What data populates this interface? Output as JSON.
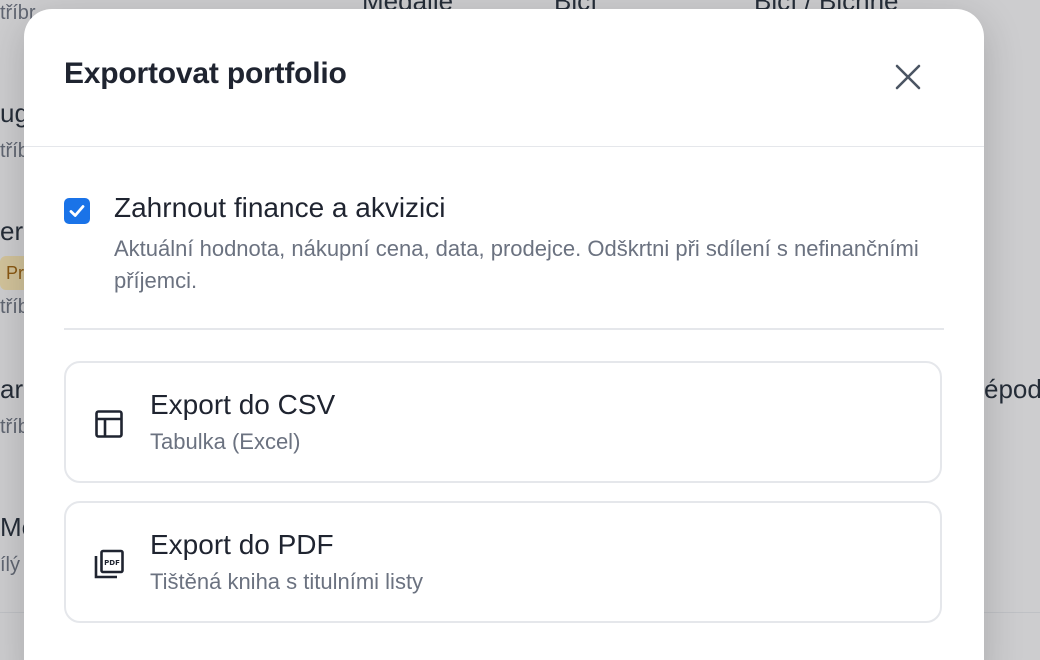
{
  "background": {
    "fragments": [
      {
        "text": "tříbr",
        "kind": "sub"
      },
      {
        "text": "Medaile",
        "kind": "main"
      },
      {
        "text": "Bicí",
        "kind": "main"
      },
      {
        "text": "Bicí / Bicnné",
        "kind": "main"
      },
      {
        "text": "ug",
        "kind": "main"
      },
      {
        "text": "tříb",
        "kind": "sub"
      },
      {
        "text": "er",
        "kind": "main"
      },
      {
        "text": "Pr",
        "kind": "pill"
      },
      {
        "text": "tříb",
        "kind": "sub"
      },
      {
        "text": "ar",
        "kind": "main"
      },
      {
        "text": "tříb",
        "kind": "sub"
      },
      {
        "text": "épod",
        "kind": "main"
      },
      {
        "text": "Me",
        "kind": "main"
      },
      {
        "text": "ílý",
        "kind": "sub"
      }
    ]
  },
  "modal": {
    "title": "Exportovat portfolio",
    "close_icon": "close-icon",
    "include_finance": {
      "checked": true,
      "label": "Zahrnout finance a akvizici",
      "description": "Aktuální hodnota, nákupní cena, data, prodejce. Odškrtni při sdílení s nefinančními příjemci."
    },
    "exports": [
      {
        "icon": "table-icon",
        "title": "Export do CSV",
        "subtitle": "Tabulka (Excel)"
      },
      {
        "icon": "pdf-icon",
        "title": "Export do PDF",
        "subtitle": "Tištěná kniha s titulními listy"
      }
    ]
  },
  "colors": {
    "accent": "#1a73e8",
    "text_primary": "#1f2430",
    "text_secondary": "#6b7280",
    "border": "#e5e7eb",
    "overlay": "rgba(60,60,66,0.22)"
  }
}
